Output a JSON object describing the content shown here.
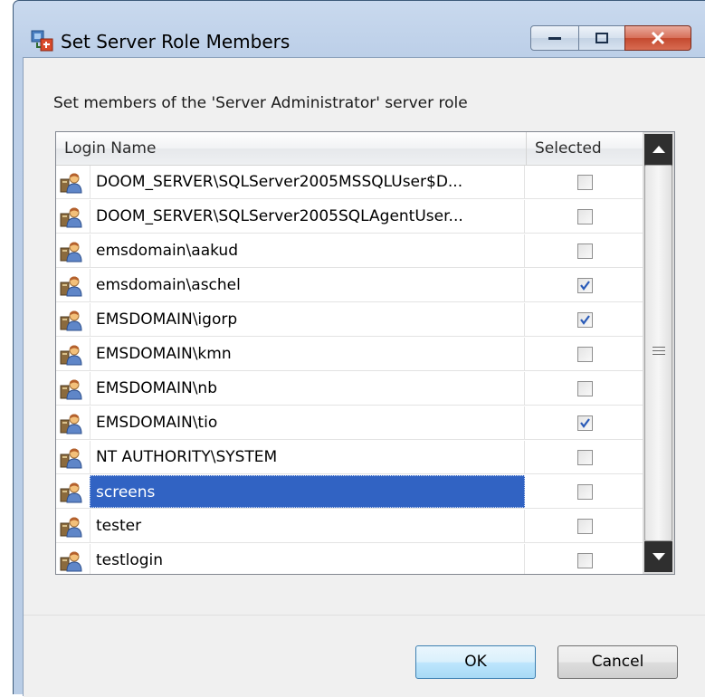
{
  "window": {
    "title": "Set Server Role Members"
  },
  "subtitle": "Set members of the 'Server Administrator' server role",
  "grid": {
    "columns": [
      "Login Name",
      "Selected"
    ],
    "rows": [
      {
        "login": "DOOM_SERVER\\SQLServer2005MSSQLUser$D...",
        "selected": false
      },
      {
        "login": "DOOM_SERVER\\SQLServer2005SQLAgentUser...",
        "selected": false
      },
      {
        "login": "emsdomain\\aakud",
        "selected": false
      },
      {
        "login": "emsdomain\\aschel",
        "selected": true
      },
      {
        "login": "EMSDOMAIN\\igorp",
        "selected": true
      },
      {
        "login": "EMSDOMAIN\\kmn",
        "selected": false
      },
      {
        "login": "EMSDOMAIN\\nb",
        "selected": false
      },
      {
        "login": "EMSDOMAIN\\tio",
        "selected": true
      },
      {
        "login": "NT AUTHORITY\\SYSTEM",
        "selected": false
      },
      {
        "login": "screens",
        "selected": false,
        "highlighted": true
      },
      {
        "login": "tester",
        "selected": false
      },
      {
        "login": "testlogin",
        "selected": false
      }
    ]
  },
  "buttons": {
    "ok": "OK",
    "cancel": "Cancel"
  },
  "icons": {
    "app": "server-role-icon",
    "user": "user-login-icon",
    "minimize": "minimize-icon",
    "maximize": "maximize-icon",
    "close": "close-icon"
  },
  "colors": {
    "selection": "#3163c3",
    "check": "#2a5bb8"
  }
}
